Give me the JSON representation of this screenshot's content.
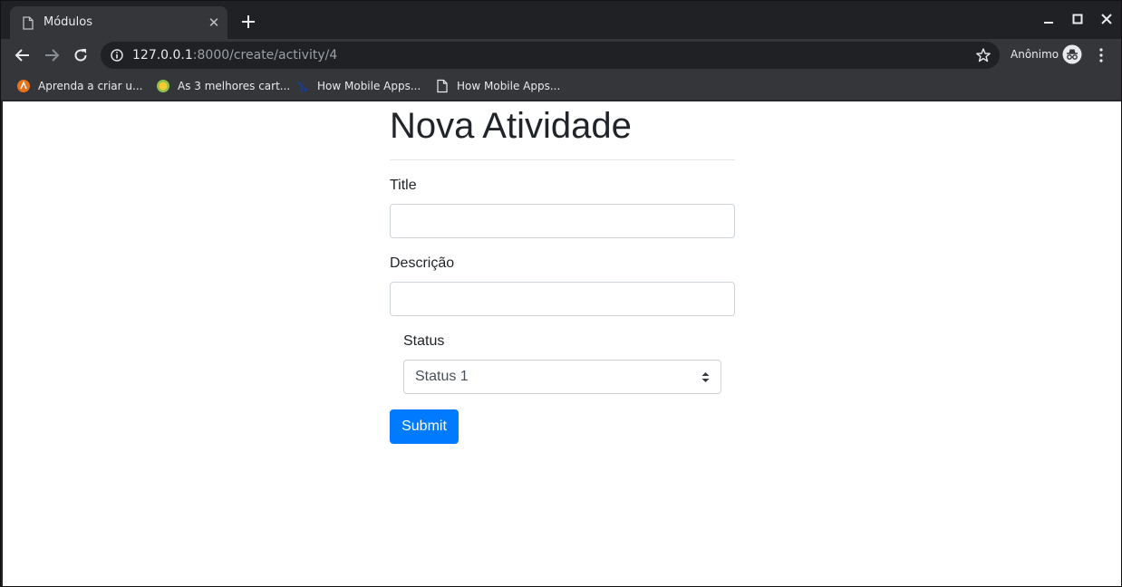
{
  "browser": {
    "tab": {
      "title": "Módulos",
      "close_glyph": "✕"
    },
    "address": {
      "host": "127.0.0.1",
      "path": ":8000/create/activity/4"
    },
    "profile": {
      "name": "Anônimo"
    },
    "bookmarks": [
      {
        "label": "Aprenda a criar u...",
        "icon": "orange-favicon-icon"
      },
      {
        "label": "As 3 melhores cart...",
        "icon": "yellow-green-favicon-icon"
      },
      {
        "label": "How Mobile Apps...",
        "icon": "blue-favicon-icon"
      },
      {
        "label": "How Mobile Apps...",
        "icon": "page-icon"
      }
    ]
  },
  "page": {
    "title": "Nova Atividade",
    "form": {
      "title_label": "Title",
      "title_value": "",
      "description_label": "Descrição",
      "description_value": "",
      "status_label": "Status",
      "status_selected": "Status 1",
      "submit_label": "Submit"
    }
  },
  "colors": {
    "primary": "#007bff",
    "tab_bg": "#35363a",
    "frame_bg": "#202124"
  }
}
